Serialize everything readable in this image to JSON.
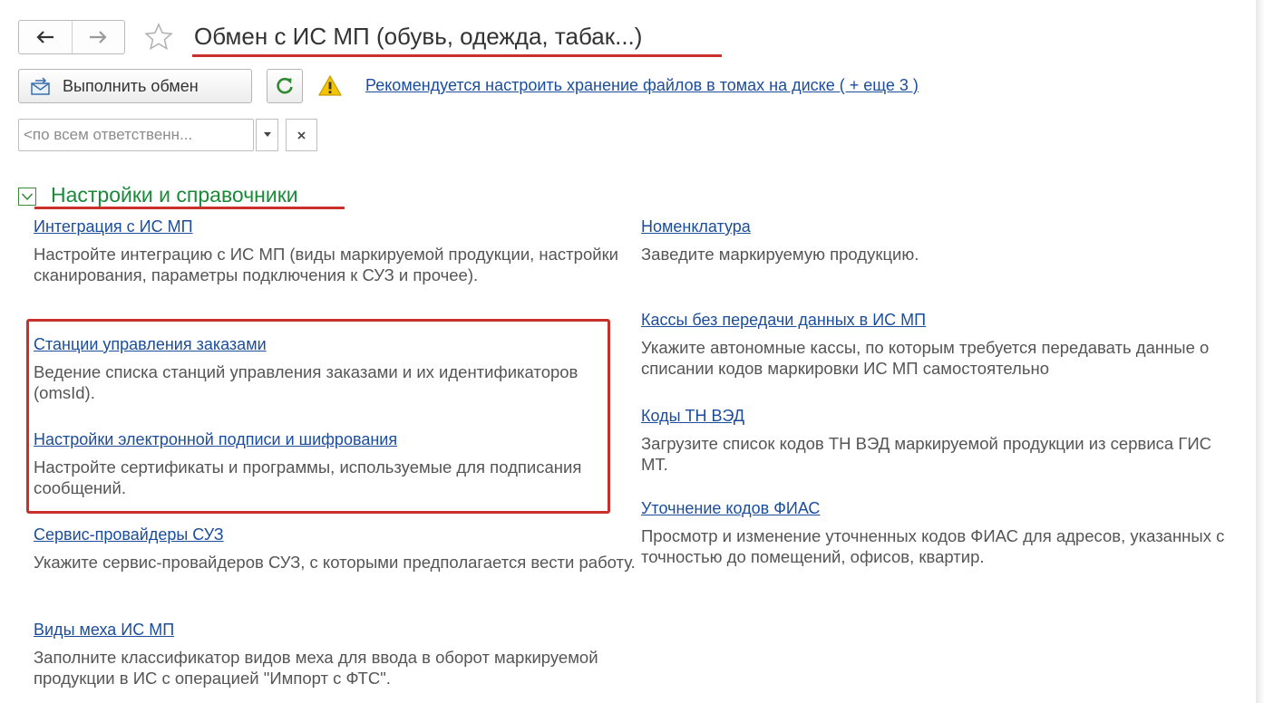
{
  "window": {
    "title": "Обмен с ИС МП (обувь, одежда, табак...)",
    "nav": {
      "back_icon": "arrow-left-icon",
      "forward_icon": "arrow-right-icon",
      "favorite_icon": "star-icon"
    }
  },
  "toolbar": {
    "run_exchange_label": "Выполнить обмен",
    "run_exchange_icon": "exchange-envelope-icon",
    "refresh_icon": "refresh-icon",
    "warning_icon": "warning-icon",
    "warning_link": "Рекомендуется настроить хранение файлов в томах на диске ( + еще 3 )"
  },
  "filter": {
    "responsible_value": "<по всем ответственн...",
    "dropdown_icon": "chevron-down-icon",
    "clear_icon": "close-icon"
  },
  "section": {
    "title": "Настройки и справочники",
    "toggle_icon": "chevron-down-icon",
    "left_items": [
      {
        "link": "Интеграция с ИС МП",
        "desc": "Настройте интеграцию с ИС МП (виды маркируемой продукции, настройки сканирования, параметры подключения к СУЗ и прочее)."
      },
      {
        "link": "Станции управления заказами",
        "desc": "Ведение списка станций управления заказами и их идентификаторов (omsId)."
      },
      {
        "link": "Настройки электронной подписи и шифрования",
        "desc": "Настройте сертификаты и программы, используемые для подписания сообщений."
      },
      {
        "link": "Сервис-провайдеры СУЗ",
        "desc": "Укажите сервис-провайдеров СУЗ, с которыми предполагается вести работу."
      },
      {
        "link": "Виды меха ИС МП",
        "desc": "Заполните классификатор видов меха для  ввода в оборот маркируемой продукции в ИС с операцией \"Импорт с ФТС\"."
      }
    ],
    "right_items": [
      {
        "link": "Номенклатура",
        "desc": "Заведите маркируемую продукцию."
      },
      {
        "link": "Кассы без передачи данных в ИС МП",
        "desc": "Укажите автономные кассы, по которым требуется передавать данные о списании кодов маркировки ИС МП самостоятельно"
      },
      {
        "link": "Коды ТН ВЭД",
        "desc": "Загрузите список кодов ТН ВЭД маркируемой продукции из сервиса ГИС МТ."
      },
      {
        "link": "Уточнение кодов ФИАС",
        "desc": "Просмотр и изменение уточненных кодов ФИАС для адресов, указанных с точностью до помещений, офисов, квартир."
      }
    ]
  },
  "colors": {
    "link": "#1b4d9c",
    "section_title": "#1a8a3a",
    "annotation_red": "#c9302c",
    "description_text": "#555555"
  }
}
